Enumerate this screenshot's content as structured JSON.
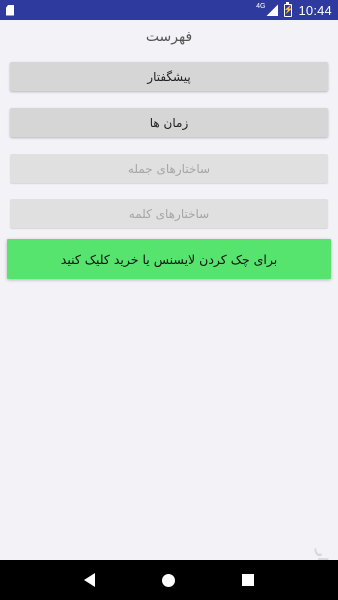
{
  "status_bar": {
    "network": "4G",
    "time": "10:44",
    "background_color": "#2e3a9e"
  },
  "header": {
    "title": "فهرست"
  },
  "menu": {
    "items": [
      {
        "label": "پیشگفتار",
        "enabled": true
      },
      {
        "label": "زمان ها",
        "enabled": true
      },
      {
        "label": "ساختارهای جمله",
        "enabled": false
      },
      {
        "label": "ساختارهای کلمه",
        "enabled": false
      }
    ]
  },
  "license_button": {
    "label": "برای چک کردن لایسنس یا خرید کلیک کنید",
    "color": "#56e36e"
  },
  "watermark": {
    "text": "بازار"
  },
  "nav_bar": {
    "icons": [
      "back-icon",
      "home-icon",
      "recent-apps-icon"
    ]
  }
}
